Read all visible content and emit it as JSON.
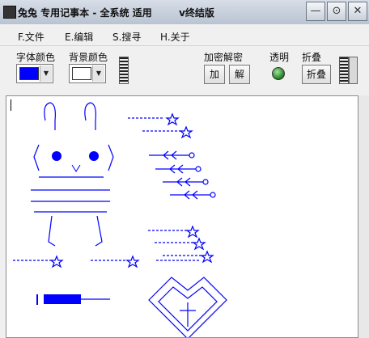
{
  "window": {
    "title": "兔兔 专用记事本 - 全系统 适用        v终结版",
    "buttons": {
      "minimize": "—",
      "restore": "⊙",
      "close": "✕"
    }
  },
  "menu": {
    "items": [
      "F.文件",
      "E.编辑",
      "S.搜寻",
      "H.关于"
    ]
  },
  "toolbar": {
    "font_color_label": "字体颜色",
    "bg_color_label": "背景颜色",
    "encrypt_label": "加密解密",
    "encrypt_button": "加",
    "decrypt_button": "解",
    "transparent_label": "透明",
    "fold_label": "折叠",
    "fold_button": "折叠",
    "font_color": "#0000ff",
    "bg_color": "#ffffff",
    "led_color": "#1e7d1e"
  },
  "editor": {
    "accent": "#0000ff"
  }
}
